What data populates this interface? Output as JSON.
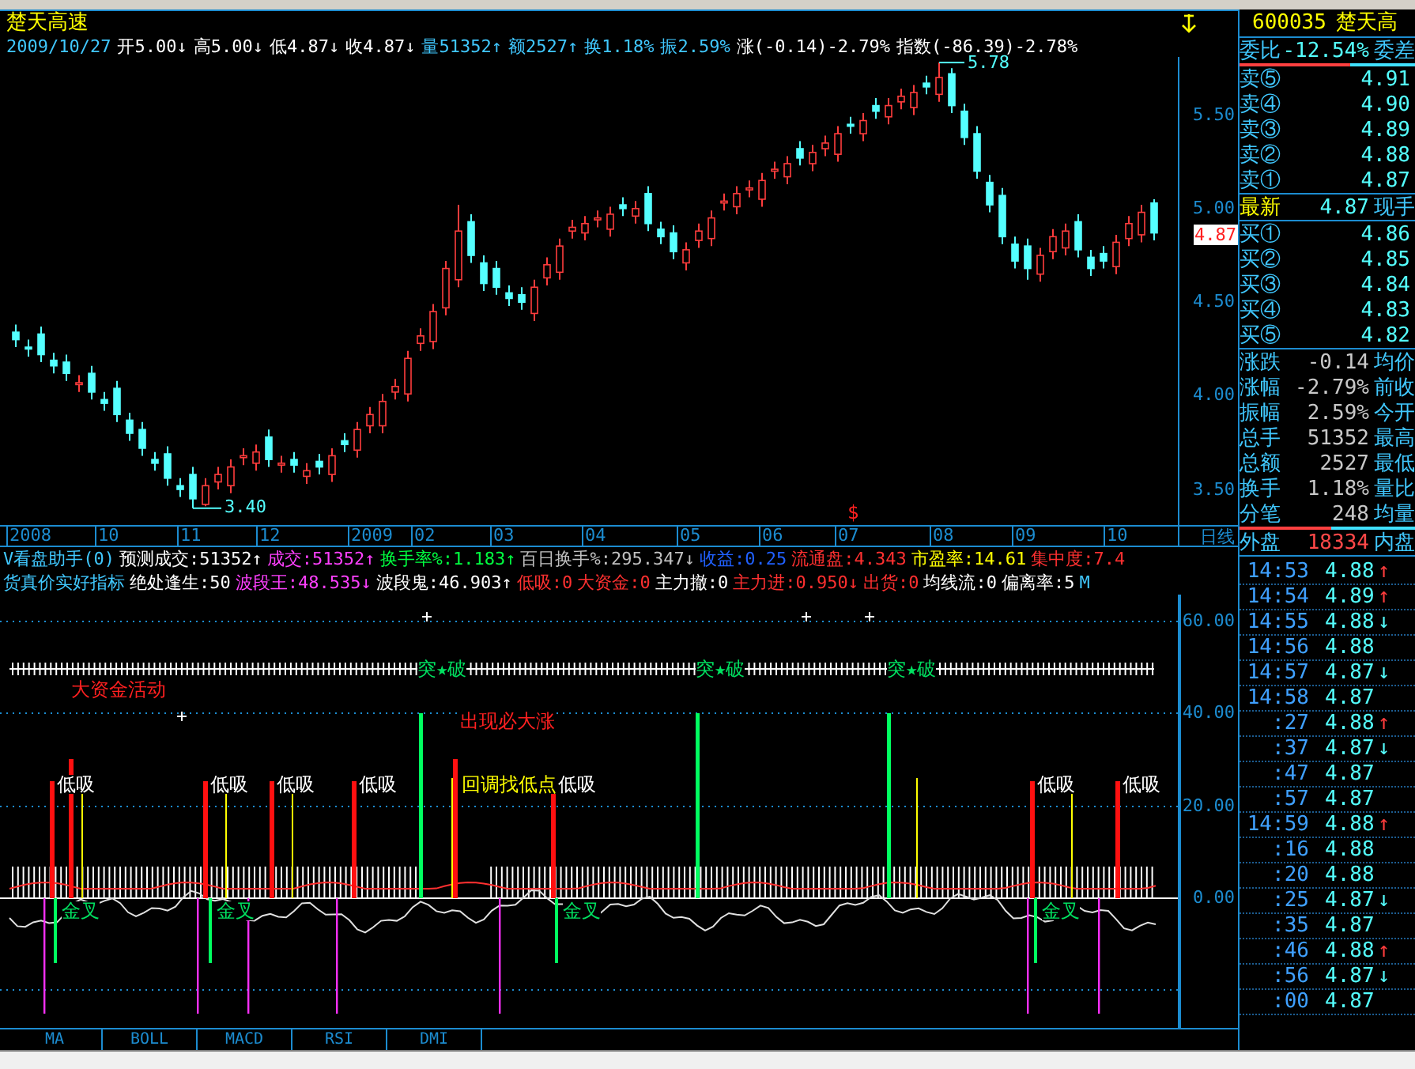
{
  "stock_title": "楚天高速",
  "quote_line": {
    "date": "2009/10/27",
    "items": [
      {
        "text": "开5.00",
        "arrow": "↓",
        "color": "#ffffff"
      },
      {
        "text": "高5.00",
        "arrow": "↓",
        "color": "#ffffff"
      },
      {
        "text": "低4.87",
        "arrow": "↓",
        "color": "#ffffff"
      },
      {
        "text": "收4.87",
        "arrow": "↓",
        "color": "#ffffff"
      },
      {
        "text": "量51352",
        "arrow": "↑",
        "color": "#40c8ff"
      },
      {
        "text": "额2527",
        "arrow": "↑",
        "color": "#40c8ff"
      },
      {
        "text": "换1.18%",
        "color": "#40c8ff"
      },
      {
        "text": "振2.59%",
        "color": "#40c8ff"
      },
      {
        "text": "涨(-0.14)-2.79%",
        "color": "#ffffff"
      },
      {
        "text": "指数(-86.39)-2.78%",
        "color": "#ffffff"
      }
    ]
  },
  "price_chart": {
    "last_price": "4.87",
    "high_label": "5.78",
    "low_label": "3.40",
    "marker": "$",
    "period": "日线",
    "chart_data": {
      "type": "candlestick",
      "ylim": [
        3.31,
        5.81
      ],
      "yticks": [
        {
          "value": 5.5,
          "label": "5.50"
        },
        {
          "value": 5.0,
          "label": "5.00"
        },
        {
          "value": 4.5,
          "label": "4.50"
        },
        {
          "value": 4.0,
          "label": "4.00"
        },
        {
          "value": 3.5,
          "label": "3.50"
        }
      ],
      "ohlc": [
        [
          4.34,
          4.38,
          4.26,
          4.3
        ],
        [
          4.26,
          4.3,
          4.21,
          4.25
        ],
        [
          4.33,
          4.37,
          4.18,
          4.22
        ],
        [
          4.19,
          4.23,
          4.12,
          4.16
        ],
        [
          4.18,
          4.22,
          4.08,
          4.12
        ],
        [
          4.06,
          4.11,
          4.02,
          4.07
        ],
        [
          4.12,
          4.16,
          3.98,
          4.02
        ],
        [
          3.98,
          4.02,
          3.92,
          3.96
        ],
        [
          4.04,
          4.08,
          3.86,
          3.9
        ],
        [
          3.87,
          3.91,
          3.76,
          3.8
        ],
        [
          3.82,
          3.86,
          3.68,
          3.72
        ],
        [
          3.66,
          3.7,
          3.6,
          3.64
        ],
        [
          3.69,
          3.73,
          3.52,
          3.56
        ],
        [
          3.52,
          3.56,
          3.46,
          3.5
        ],
        [
          3.58,
          3.62,
          3.4,
          3.45
        ],
        [
          3.42,
          3.56,
          3.41,
          3.52
        ],
        [
          3.54,
          3.62,
          3.5,
          3.58
        ],
        [
          3.52,
          3.66,
          3.48,
          3.62
        ],
        [
          3.67,
          3.72,
          3.63,
          3.68
        ],
        [
          3.64,
          3.74,
          3.6,
          3.7
        ],
        [
          3.78,
          3.82,
          3.62,
          3.66
        ],
        [
          3.63,
          3.68,
          3.59,
          3.64
        ],
        [
          3.66,
          3.7,
          3.59,
          3.63
        ],
        [
          3.57,
          3.64,
          3.53,
          3.6
        ],
        [
          3.65,
          3.69,
          3.58,
          3.62
        ],
        [
          3.58,
          3.72,
          3.54,
          3.68
        ],
        [
          3.76,
          3.8,
          3.7,
          3.74
        ],
        [
          3.71,
          3.86,
          3.67,
          3.82
        ],
        [
          3.84,
          3.94,
          3.8,
          3.9
        ],
        [
          3.84,
          4.01,
          3.8,
          3.97
        ],
        [
          4.02,
          4.09,
          3.98,
          4.05
        ],
        [
          4.01,
          4.24,
          3.97,
          4.2
        ],
        [
          4.28,
          4.36,
          4.24,
          4.32
        ],
        [
          4.29,
          4.49,
          4.25,
          4.45
        ],
        [
          4.47,
          4.72,
          4.43,
          4.68
        ],
        [
          4.62,
          5.02,
          4.58,
          4.88
        ],
        [
          4.93,
          4.97,
          4.71,
          4.75
        ],
        [
          4.71,
          4.75,
          4.56,
          4.6
        ],
        [
          4.68,
          4.72,
          4.54,
          4.58
        ],
        [
          4.55,
          4.59,
          4.48,
          4.52
        ],
        [
          4.54,
          4.58,
          4.46,
          4.5
        ],
        [
          4.44,
          4.62,
          4.4,
          4.58
        ],
        [
          4.63,
          4.74,
          4.59,
          4.7
        ],
        [
          4.66,
          4.84,
          4.62,
          4.8
        ],
        [
          4.88,
          4.94,
          4.84,
          4.9
        ],
        [
          4.87,
          4.96,
          4.83,
          4.92
        ],
        [
          4.94,
          4.99,
          4.9,
          4.95
        ],
        [
          4.89,
          5.01,
          4.85,
          4.97
        ],
        [
          5.02,
          5.06,
          4.96,
          5.0
        ],
        [
          4.96,
          5.04,
          4.92,
          5.0
        ],
        [
          5.08,
          5.12,
          4.88,
          4.92
        ],
        [
          4.89,
          4.93,
          4.81,
          4.85
        ],
        [
          4.87,
          4.91,
          4.73,
          4.77
        ],
        [
          4.71,
          4.82,
          4.67,
          4.78
        ],
        [
          4.83,
          4.92,
          4.79,
          4.88
        ],
        [
          4.84,
          4.99,
          4.8,
          4.95
        ],
        [
          5.03,
          5.08,
          4.99,
          5.04
        ],
        [
          5.01,
          5.12,
          4.97,
          5.08
        ],
        [
          5.1,
          5.15,
          5.06,
          5.11
        ],
        [
          5.05,
          5.19,
          5.01,
          5.15
        ],
        [
          5.2,
          5.25,
          5.16,
          5.21
        ],
        [
          5.17,
          5.28,
          5.13,
          5.24
        ],
        [
          5.32,
          5.36,
          5.23,
          5.27
        ],
        [
          5.24,
          5.34,
          5.2,
          5.3
        ],
        [
          5.32,
          5.39,
          5.28,
          5.35
        ],
        [
          5.29,
          5.44,
          5.25,
          5.4
        ],
        [
          5.45,
          5.49,
          5.4,
          5.44
        ],
        [
          5.4,
          5.51,
          5.36,
          5.47
        ],
        [
          5.55,
          5.59,
          5.48,
          5.52
        ],
        [
          5.49,
          5.59,
          5.45,
          5.55
        ],
        [
          5.57,
          5.64,
          5.53,
          5.6
        ],
        [
          5.54,
          5.66,
          5.5,
          5.62
        ],
        [
          5.67,
          5.71,
          5.61,
          5.65
        ],
        [
          5.61,
          5.78,
          5.57,
          5.7
        ],
        [
          5.72,
          5.75,
          5.51,
          5.55
        ],
        [
          5.52,
          5.56,
          5.34,
          5.38
        ],
        [
          5.4,
          5.44,
          5.16,
          5.2
        ],
        [
          5.14,
          5.18,
          4.98,
          5.02
        ],
        [
          5.07,
          5.11,
          4.81,
          4.85
        ],
        [
          4.81,
          4.85,
          4.68,
          4.72
        ],
        [
          4.8,
          4.84,
          4.62,
          4.68
        ],
        [
          4.65,
          4.79,
          4.61,
          4.75
        ],
        [
          4.77,
          4.89,
          4.73,
          4.85
        ],
        [
          4.79,
          4.92,
          4.75,
          4.88
        ],
        [
          4.93,
          4.97,
          4.74,
          4.78
        ],
        [
          4.74,
          4.78,
          4.64,
          4.68
        ],
        [
          4.76,
          4.8,
          4.68,
          4.72
        ],
        [
          4.69,
          4.86,
          4.65,
          4.82
        ],
        [
          4.84,
          4.96,
          4.8,
          4.92
        ],
        [
          4.86,
          5.02,
          4.82,
          4.98
        ],
        [
          5.03,
          5.05,
          4.83,
          4.87
        ]
      ]
    }
  },
  "date_axis": [
    "2008",
    "10",
    "11",
    "12",
    "2009",
    "02",
    "03",
    "04",
    "05",
    "06",
    "07",
    "08",
    "09",
    "10"
  ],
  "indicators": [
    {
      "name": "V看盘助手(0)",
      "items": [
        {
          "text": "预测成交:51352",
          "arrow": "↑",
          "color": "#ffffff"
        },
        {
          "text": "成交:51352",
          "arrow": "↑",
          "color": "#ff40ff"
        },
        {
          "text": "换手率%:1.183",
          "arrow": "↑",
          "color": "#00ff40"
        },
        {
          "text": "百日换手%:295.347",
          "arrow": "↓",
          "color": "#c0c0c0"
        },
        {
          "text": "收益:0.25",
          "color": "#2060ff"
        },
        {
          "text": "流通盘:4.343",
          "color": "#ff3030"
        },
        {
          "text": "市盈率:14.61",
          "color": "#ffff00"
        },
        {
          "text": "集中度:7.4",
          "color": "#ff3030"
        }
      ]
    },
    {
      "name": "货真价实好指标",
      "items": [
        {
          "text": "绝处逢生:50",
          "color": "#ffffff"
        },
        {
          "text": "波段王:48.535",
          "arrow": "↓",
          "color": "#ff40ff"
        },
        {
          "text": "波段鬼:46.903",
          "arrow": "↑",
          "color": "#ffffff"
        },
        {
          "text": "低吸:0",
          "color": "#ff3030"
        },
        {
          "text": "大资金:0",
          "color": "#ff3030"
        },
        {
          "text": "主力撤:0",
          "color": "#ffffff"
        },
        {
          "text": "主力进:0.950",
          "arrow": "↓",
          "color": "#ff3030"
        },
        {
          "text": "出货:0",
          "color": "#ff3030"
        },
        {
          "text": "均线流:0",
          "color": "#ffffff"
        },
        {
          "text": "偏离率:5",
          "color": "#ffffff"
        },
        {
          "text": "M",
          "color": "#40c8ff"
        }
      ]
    }
  ],
  "signal_chart": {
    "y_axis": [
      "60.00",
      "40.00",
      "20.00",
      "0.00"
    ],
    "labels": [
      {
        "text": "突★破",
        "color": "#00e060"
      },
      {
        "text": "突★破",
        "color": "#00e060"
      },
      {
        "text": "突★破",
        "color": "#00e060"
      },
      {
        "text": "大资金活动",
        "color": "#ff2020"
      },
      {
        "text": "出现必大涨",
        "color": "#ff2020"
      },
      {
        "text": "低吸",
        "color": "#ffffff"
      },
      {
        "text": "低吸",
        "color": "#ffffff"
      },
      {
        "text": "低吸",
        "color": "#ffffff"
      },
      {
        "text": "低吸",
        "color": "#ffffff"
      },
      {
        "text": "回调找低点",
        "color": "#ffff00"
      },
      {
        "text": "低吸",
        "color": "#ffffff"
      },
      {
        "text": "低吸",
        "color": "#ffffff"
      },
      {
        "text": "低吸",
        "color": "#ffffff"
      },
      {
        "text": "金叉",
        "color": "#00e060"
      },
      {
        "text": "金叉",
        "color": "#00e060"
      },
      {
        "text": "金叉",
        "color": "#00e060"
      },
      {
        "text": "金叉",
        "color": "#00e060"
      }
    ]
  },
  "tabs": [
    "MA",
    "BOLL",
    "MACD",
    "RSI",
    "DMI"
  ],
  "quote_panel": {
    "code": "600035",
    "name": "楚天高",
    "ratio": {
      "label": "委比",
      "value": "-12.54%",
      "side_label": "委差",
      "level": 0.63
    },
    "asks": [
      {
        "label": "卖⑤",
        "price": "4.91"
      },
      {
        "label": "卖④",
        "price": "4.90"
      },
      {
        "label": "卖③",
        "price": "4.89"
      },
      {
        "label": "卖②",
        "price": "4.88"
      },
      {
        "label": "卖①",
        "price": "4.87"
      }
    ],
    "last": {
      "label": "最新",
      "price": "4.87",
      "side_label": "现手"
    },
    "bids": [
      {
        "label": "买①",
        "price": "4.86"
      },
      {
        "label": "买②",
        "price": "4.85"
      },
      {
        "label": "买③",
        "price": "4.84"
      },
      {
        "label": "买④",
        "price": "4.83"
      },
      {
        "label": "买⑤",
        "price": "4.82"
      }
    ],
    "stats": [
      {
        "label": "涨跌",
        "value": "-0.14",
        "side_label": "均价"
      },
      {
        "label": "涨幅",
        "value": "-2.79%",
        "side_label": "前收"
      },
      {
        "label": "振幅",
        "value": "2.59%",
        "side_label": "今开"
      },
      {
        "label": "总手",
        "value": "51352",
        "side_label": "最高"
      },
      {
        "label": "总额",
        "value": "2527",
        "side_label": "最低"
      },
      {
        "label": "换手",
        "value": "1.18%",
        "side_label": "量比"
      },
      {
        "label": "分笔",
        "value": "248",
        "side_label": "均量"
      }
    ],
    "outer": {
      "label": "外盘",
      "value": "18334",
      "side_label": "内盘",
      "level": 0.52
    },
    "ticks": [
      {
        "time": "14:53",
        "price": "4.88",
        "arrow": "↑",
        "kind": "up"
      },
      {
        "time": "14:54",
        "price": "4.89",
        "arrow": "↑",
        "kind": "up"
      },
      {
        "time": "14:55",
        "price": "4.88",
        "arrow": "↓",
        "kind": "down"
      },
      {
        "time": "14:56",
        "price": "4.88"
      },
      {
        "time": "14:57",
        "price": "4.87",
        "arrow": "↓",
        "kind": "down"
      },
      {
        "time": "14:58",
        "price": "4.87"
      },
      {
        "time": ":27",
        "price": "4.88",
        "arrow": "↑",
        "kind": "up"
      },
      {
        "time": ":37",
        "price": "4.87",
        "arrow": "↓",
        "kind": "down"
      },
      {
        "time": ":47",
        "price": "4.87"
      },
      {
        "time": ":57",
        "price": "4.87"
      },
      {
        "time": "14:59",
        "price": "4.88",
        "arrow": "↑",
        "kind": "up"
      },
      {
        "time": ":16",
        "price": "4.88"
      },
      {
        "time": ":20",
        "price": "4.88"
      },
      {
        "time": ":25",
        "price": "4.87",
        "arrow": "↓",
        "kind": "down"
      },
      {
        "time": ":35",
        "price": "4.87"
      },
      {
        "time": ":46",
        "price": "4.88",
        "arrow": "↑",
        "kind": "up"
      },
      {
        "time": ":56",
        "price": "4.87",
        "arrow": "↓",
        "kind": "down"
      },
      {
        "time": ":00",
        "price": "4.87"
      }
    ]
  }
}
